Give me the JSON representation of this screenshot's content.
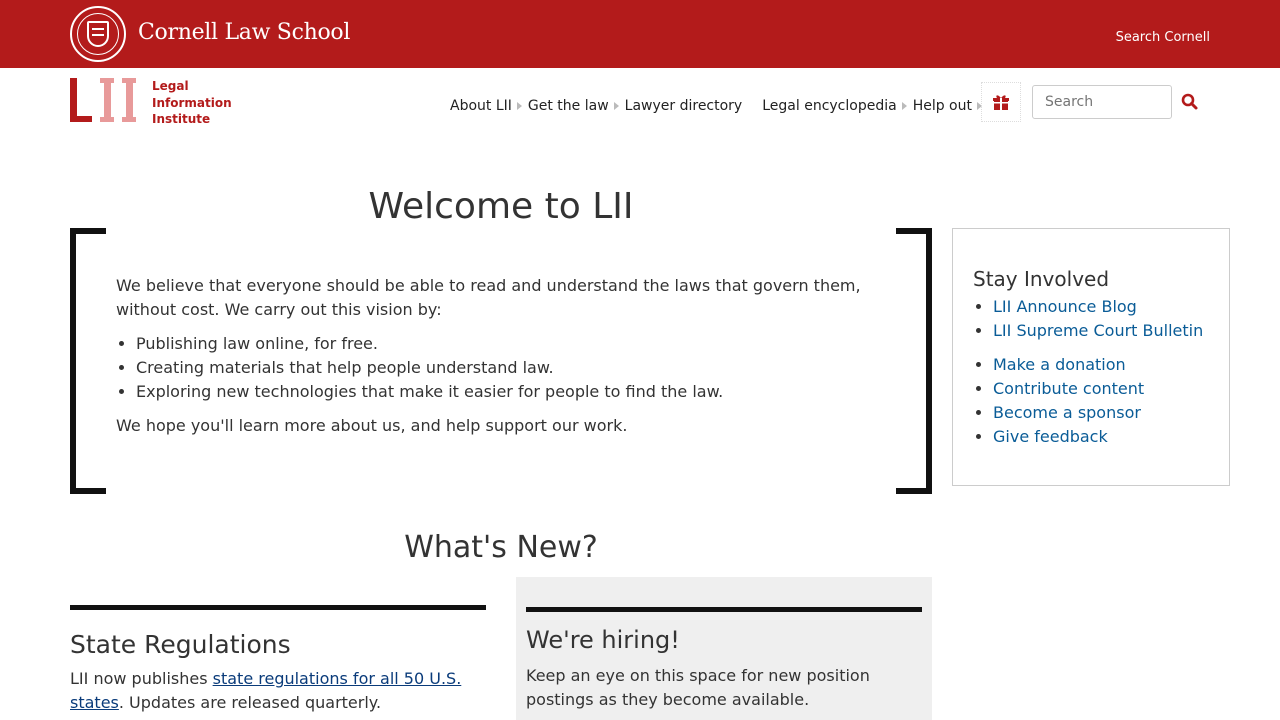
{
  "header": {
    "school_name": "Cornell Law School",
    "search_cornell": "Search Cornell"
  },
  "lii": {
    "logo_letters": "LII",
    "logo_line1": "Legal",
    "logo_line2": "Information",
    "logo_line3": "Institute"
  },
  "nav": {
    "items": [
      {
        "label": "About LII"
      },
      {
        "label": "Get the law"
      },
      {
        "label": "Lawyer directory"
      },
      {
        "label": "Legal encyclopedia"
      },
      {
        "label": "Help out"
      }
    ],
    "search_placeholder": "Search"
  },
  "welcome": {
    "title": "Welcome to LII",
    "intro": "We believe that everyone should be able to read and understand the laws that govern them, without cost. We carry out this vision by:",
    "bullets": [
      "Publishing law online, for free.",
      "Creating materials that help people understand law.",
      "Exploring new technologies that make it easier for people to find the law."
    ],
    "outro": "We hope you'll learn more about us, and help support our work."
  },
  "stay_involved": {
    "title": "Stay Involved",
    "links_group1": [
      "LII Announce Blog",
      "LII Supreme Court Bulletin"
    ],
    "links_group2": [
      "Make a donation",
      "Contribute content",
      "Become a sponsor",
      "Give feedback"
    ]
  },
  "whats_new": {
    "title": "What's New?",
    "left_card": {
      "title": "State Regulations",
      "text_before": "LII now publishes ",
      "link": "state regulations for all 50 U.S. states",
      "text_after": ". Updates are released quarterly."
    },
    "right_card": {
      "title": "We're hiring!",
      "text": "Keep an eye on this space for new position postings as they become available."
    }
  },
  "colors": {
    "cornell_red": "#b31b1b",
    "link_blue": "#0a5c97",
    "lii_light_red": "#e89a9a"
  }
}
